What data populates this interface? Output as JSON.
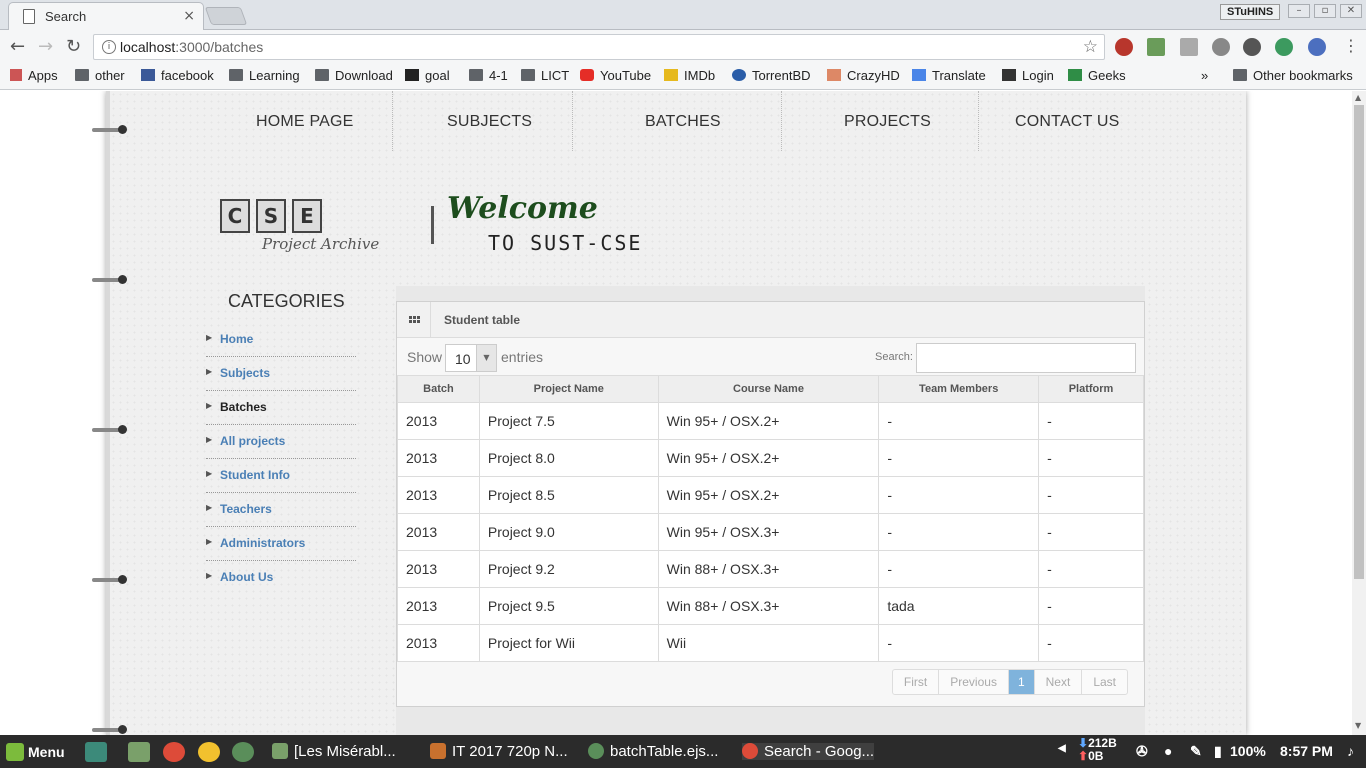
{
  "browser": {
    "tab_title": "Search",
    "tab_close": "×",
    "profile": "STuHINS",
    "url_host": "localhost",
    "url_path": ":3000/batches",
    "bookmarks": [
      "Apps",
      "other",
      "facebook",
      "Learning",
      "Download",
      "goal",
      "4-1",
      "LICT",
      "YouTube",
      "IMDb",
      "TorrentBD",
      "CrazyHD",
      "Translate",
      "Login",
      "Geeks"
    ],
    "overflow": "»",
    "other_bookmarks": "Other bookmarks"
  },
  "nav": {
    "items": [
      "HOME PAGE",
      "SUBJECTS",
      "BATCHES",
      "PROJECTS",
      "CONTACT US"
    ]
  },
  "header": {
    "logo_letters": [
      "C",
      "S",
      "E"
    ],
    "logo_sub": "Project Archive",
    "welcome": "Welcome",
    "to_sust": "TO SUST-CSE"
  },
  "sidebar": {
    "title": "CATEGORIES",
    "items": [
      {
        "label": "Home",
        "active": false
      },
      {
        "label": "Subjects",
        "active": false
      },
      {
        "label": "Batches",
        "active": true
      },
      {
        "label": "All projects",
        "active": false
      },
      {
        "label": "Student Info",
        "active": false
      },
      {
        "label": "Teachers",
        "active": false
      },
      {
        "label": "Administrators",
        "active": false
      },
      {
        "label": "About Us",
        "active": false
      }
    ]
  },
  "widget": {
    "title": "Student table",
    "show_label": "Show",
    "show_value": "10",
    "entries_label": "entries",
    "search_label": "Search:",
    "search_value": "",
    "columns": [
      "Batch",
      "Project Name",
      "Course Name",
      "Team Members",
      "Platform"
    ],
    "rows": [
      [
        "2013",
        "Project 7.5",
        "Win 95+ / OSX.2+",
        "-",
        "-"
      ],
      [
        "2013",
        "Project 8.0",
        "Win 95+ / OSX.2+",
        "-",
        "-"
      ],
      [
        "2013",
        "Project 8.5",
        "Win 95+ / OSX.2+",
        "-",
        "-"
      ],
      [
        "2013",
        "Project 9.0",
        "Win 95+ / OSX.3+",
        "-",
        "-"
      ],
      [
        "2013",
        "Project 9.2",
        "Win 88+ / OSX.3+",
        "-",
        "-"
      ],
      [
        "2013",
        "Project 9.5",
        "Win 88+ / OSX.3+",
        "tada",
        "-"
      ],
      [
        "2013",
        "Project for Wii",
        "Wii",
        "-",
        "-"
      ]
    ],
    "pager": [
      "First",
      "Previous",
      "1",
      "Next",
      "Last"
    ],
    "current_page": "1"
  },
  "taskbar": {
    "menu": "Menu",
    "tasks": [
      "[Les Misérabl...",
      "IT 2017 720p N...",
      "batchTable.ejs...",
      "Search - Goog..."
    ],
    "net_down": "212B",
    "net_up": "0B",
    "battery": "100%",
    "clock": "8:57 PM"
  }
}
